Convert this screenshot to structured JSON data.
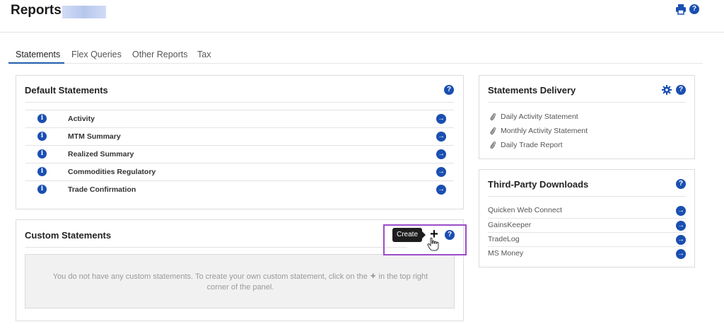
{
  "header": {
    "title": "Reports",
    "print_icon": "print-icon",
    "help_icon": "help-icon"
  },
  "tabs": [
    {
      "label": "Statements",
      "active": true
    },
    {
      "label": "Flex Queries",
      "active": false
    },
    {
      "label": "Other Reports",
      "active": false
    },
    {
      "label": "Tax",
      "active": false
    }
  ],
  "default_statements": {
    "title": "Default Statements",
    "items": [
      {
        "label": "Activity"
      },
      {
        "label": "MTM Summary"
      },
      {
        "label": "Realized Summary"
      },
      {
        "label": "Commodities Regulatory"
      },
      {
        "label": "Trade Confirmation"
      }
    ]
  },
  "custom_statements": {
    "title": "Custom Statements",
    "tooltip": "Create",
    "empty_line1_before": "You do not have any custom statements. To create your own custom statement, click on the",
    "empty_line1_after": "in the top right",
    "empty_line2": "corner of the panel."
  },
  "statements_delivery": {
    "title": "Statements Delivery",
    "items": [
      {
        "label": "Daily Activity Statement"
      },
      {
        "label": "Monthly Activity Statement"
      },
      {
        "label": "Daily Trade Report"
      }
    ]
  },
  "third_party_downloads": {
    "title": "Third-Party Downloads",
    "items": [
      {
        "label": "Quicken Web Connect"
      },
      {
        "label": "GainsKeeper"
      },
      {
        "label": "TradeLog"
      },
      {
        "label": "MS Money"
      }
    ]
  },
  "colors": {
    "accent": "#1a4fb1",
    "tab_underline": "#1f5fa8",
    "highlight": "#9c4cc9"
  }
}
